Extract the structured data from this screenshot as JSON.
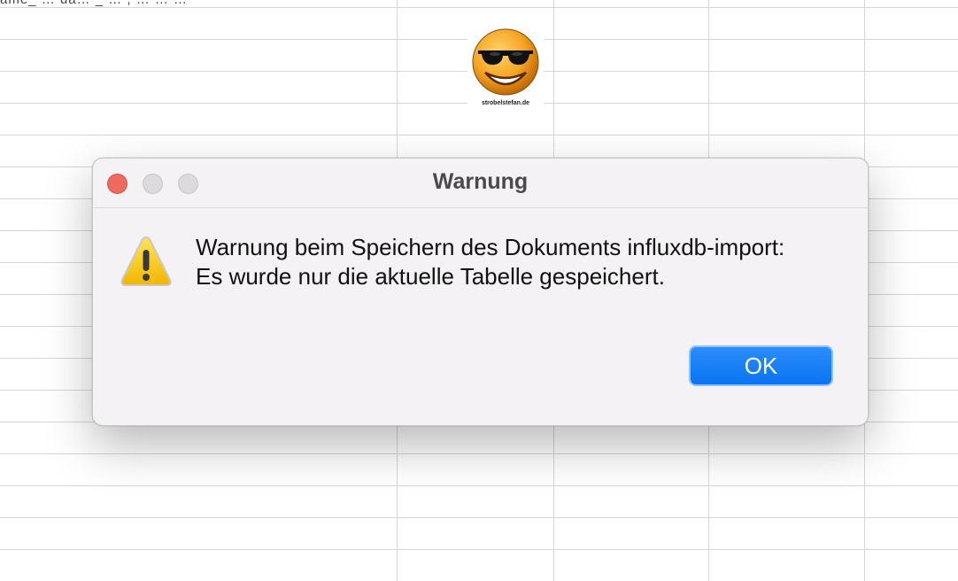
{
  "background": {
    "top_row_text": "ame_ … ua… _ … ; … … …"
  },
  "logo": {
    "icon": "sunglasses-smiley-icon",
    "caption": "strobelstefan.de"
  },
  "dialog": {
    "title": "Warnung",
    "icon": "warning-triangle-icon",
    "message_line1": "Warnung beim Speichern des Dokuments influxdb-import:",
    "message_line2": "Es wurde nur die aktuelle Tabelle gespeichert.",
    "ok_label": "OK",
    "traffic_lights": {
      "close_color": "#ed6a5e",
      "inactive_color": "#dcdbdc"
    },
    "accent": "#0a73f2"
  }
}
